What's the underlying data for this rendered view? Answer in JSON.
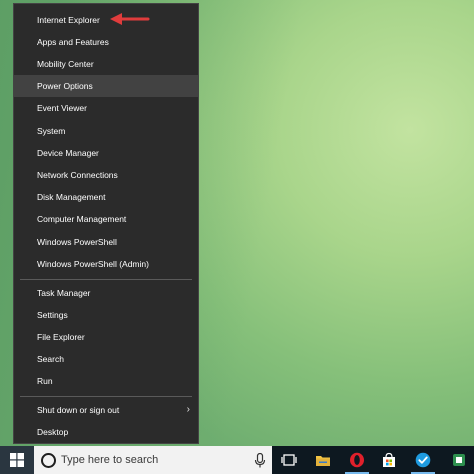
{
  "menu": {
    "items": [
      {
        "label": "Internet Explorer"
      },
      {
        "label": "Apps and Features"
      },
      {
        "label": "Mobility Center"
      },
      {
        "label": "Power Options"
      },
      {
        "label": "Event Viewer"
      },
      {
        "label": "System"
      },
      {
        "label": "Device Manager"
      },
      {
        "label": "Network Connections"
      },
      {
        "label": "Disk Management"
      },
      {
        "label": "Computer Management"
      },
      {
        "label": "Windows PowerShell"
      },
      {
        "label": "Windows PowerShell (Admin)"
      },
      {
        "label": "Task Manager"
      },
      {
        "label": "Settings"
      },
      {
        "label": "File Explorer"
      },
      {
        "label": "Search"
      },
      {
        "label": "Run"
      },
      {
        "label": "Shut down or sign out"
      },
      {
        "label": "Desktop"
      }
    ],
    "highlighted_item": "Power Options"
  },
  "annotation": {
    "arrow_color": "#e03c3c",
    "points_to": "Internet Explorer"
  },
  "taskbar": {
    "search_placeholder": "Type here to search",
    "icons": [
      "start-windows-icon",
      "search-icon",
      "microphone-icon",
      "task-view-icon",
      "file-explorer-icon",
      "opera-icon",
      "store-icon",
      "check-app-icon"
    ],
    "accent_color": "#76b9ed"
  }
}
